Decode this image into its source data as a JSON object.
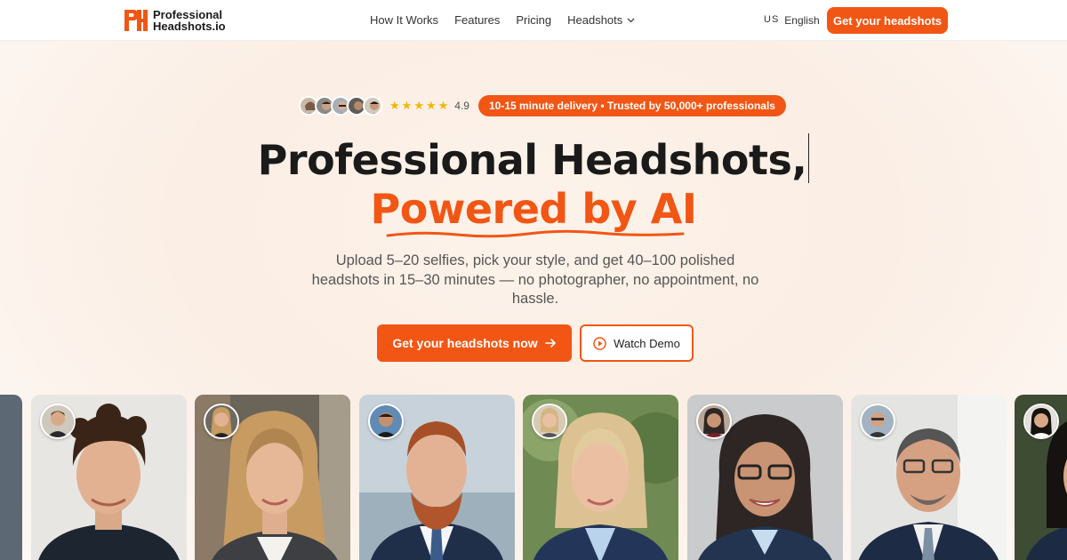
{
  "brand": {
    "line1": "Professional",
    "line2": "Headshots.io",
    "mark": "PH",
    "accent": "#f25614"
  },
  "nav": {
    "items": [
      "How It Works",
      "Features",
      "Pricing",
      "Headshots"
    ],
    "language_flag": "US",
    "language": "English",
    "cta": "Get your headshots"
  },
  "trust": {
    "rating": "4.9",
    "stars": 5,
    "badge": "10-15 minute delivery • Trusted by 50,000+ professionals"
  },
  "hero": {
    "headline": "Professional Headshots,",
    "headline_accent": "Powered by AI",
    "subtitle": "Upload 5–20 selfies, pick your style, and get 40–100 polished headshots in 15–30 minutes — no photographer, no appointment, no hassle.",
    "primary_cta": "Get your headshots now",
    "secondary_cta": "Watch Demo"
  },
  "icons": {
    "arrow": "arrow-right-icon",
    "play": "play-circle-icon",
    "chevron": "chevron-down-icon",
    "star": "star-icon"
  },
  "colors": {
    "accent": "#f25614",
    "star": "#f5b400",
    "text": "#1a1a1a"
  }
}
